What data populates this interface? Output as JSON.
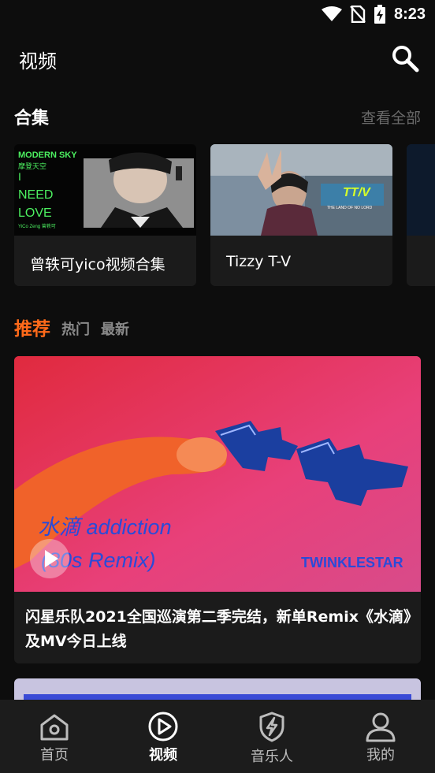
{
  "status": {
    "time": "8:23"
  },
  "header": {
    "title": "视频"
  },
  "collections": {
    "title": "合集",
    "see_all": "查看全部",
    "items": [
      {
        "label": "曾轶可yico视频合集",
        "thumb_text": [
          "MODERN SKY",
          "摩登天空",
          "I",
          "NEED",
          "LOVE",
          "YiCo Zeng 曾轶可"
        ]
      },
      {
        "label": "Tizzy T-V",
        "thumb_text": [
          "TT/V",
          "THE LAND OF NO LORD"
        ]
      }
    ]
  },
  "feed_tabs": {
    "active": "推荐",
    "items": [
      "热门",
      "最新"
    ]
  },
  "feature": {
    "title": "闪星乐队2021全国巡演第二季完结，新单Remix《水滴》及MV今日上线",
    "thumb_text": {
      "line1": "水滴 addiction",
      "line2": "(80s Remix)",
      "brand": "TWINKLESTAR"
    }
  },
  "bottom_nav": [
    {
      "label": "首页",
      "icon": "home-icon"
    },
    {
      "label": "视频",
      "icon": "play-circle-icon"
    },
    {
      "label": "音乐人",
      "icon": "lightning-shield-icon"
    },
    {
      "label": "我的",
      "icon": "person-icon"
    }
  ]
}
